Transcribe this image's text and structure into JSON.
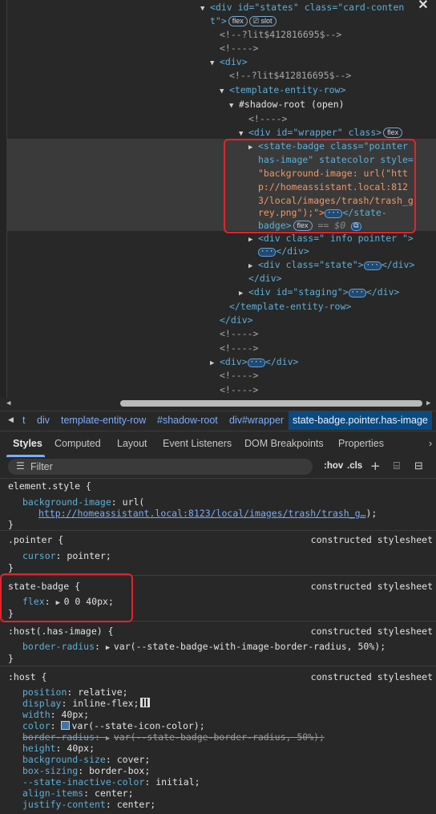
{
  "tree": {
    "l1a": "<div id=\"states\" class=\"card-conten",
    "l1b": "t\">",
    "flex": "flex",
    "slot": "slot",
    "l2": "<!--?lit$412816695$-->",
    "l3": "<!---->",
    "l4": "<div>",
    "l5": "<!--?lit$412816695$-->",
    "l6": "<template-entity-row>",
    "l7": "#shadow-root (open)",
    "l8": "<!---->",
    "l9": "<div id=\"wrapper\" class>",
    "l10": "<state-badge class=\"pointer",
    "l11": "has-image\" statecolor style=",
    "l12": "\"background-image: url(\"htt",
    "l13": "p://homeassistant.local:812",
    "l14": "3/local/images/trash/trash_g",
    "l15": "rey.png\");\">",
    "l15b": "</state-",
    "l16": "badge>",
    "dollar": "== $0",
    "l17": "<div class=\" info pointer \">",
    "l18": "</div>",
    "l19": "<div class=\"state\">",
    "l19b": "</div>",
    "l20": "</div>",
    "l21": "<div id=\"staging\">",
    "l21b": "</div>",
    "l22": "</template-entity-row>",
    "l23": "</div>",
    "l24": "<!---->",
    "l25": "<!---->",
    "l26": "<div>",
    "l26b": "</div>",
    "l27": "<!---->",
    "l28": "<!---->",
    "ellipsis": "···"
  },
  "breadcrumb": {
    "items": [
      "t",
      "div",
      "template-entity-row",
      "#shadow-root",
      "div#wrapper"
    ],
    "selected": "state-badge.pointer.has-image"
  },
  "tabs": [
    "Styles",
    "Computed",
    "Layout",
    "Event Listeners",
    "DOM Breakpoints",
    "Properties"
  ],
  "filter": {
    "placeholder": "Filter",
    "hov": ":hov",
    "cls": ".cls"
  },
  "rules": {
    "element_style": {
      "selector": "element.style {",
      "prop": "background-image",
      "val_pre": "url(",
      "link": "http://homeassistant.local:8123/local/images/trash/trash_g…",
      "val_post": ");"
    },
    "pointer": {
      "selector": ".pointer {",
      "source": "constructed stylesheet",
      "prop": "cursor",
      "val": "pointer;"
    },
    "state_badge": {
      "selector": "state-badge {",
      "source": "constructed stylesheet",
      "prop": "flex",
      "val": "0 0 40px;"
    },
    "host_has_image": {
      "selector": ":host(.has-image) {",
      "source": "constructed stylesheet",
      "prop": "border-radius",
      "val": "var(--state-badge-with-image-border-radius, 50%);"
    },
    "host": {
      "selector": ":host {",
      "source": "constructed stylesheet",
      "decls": [
        {
          "p": "position",
          "v": "relative;"
        },
        {
          "p": "display",
          "v": "inline-flex;"
        },
        {
          "p": "width",
          "v": "40px;"
        },
        {
          "p": "color",
          "v": "var(--state-icon-color);"
        },
        {
          "p": "border-radius",
          "v": "var(--state-badge-border-radius, 50%);"
        },
        {
          "p": "height",
          "v": "40px;"
        },
        {
          "p": "background-size",
          "v": "cover;"
        },
        {
          "p": "box-sizing",
          "v": "border-box;"
        },
        {
          "p": "--state-inactive-color",
          "v": "initial;"
        },
        {
          "p": "align-items",
          "v": "center;"
        },
        {
          "p": "justify-content",
          "v": "center;"
        }
      ]
    },
    "close_brace": "}"
  },
  "colors": {
    "highlight_box": "#e0242c",
    "accent": "#7cacf8"
  }
}
